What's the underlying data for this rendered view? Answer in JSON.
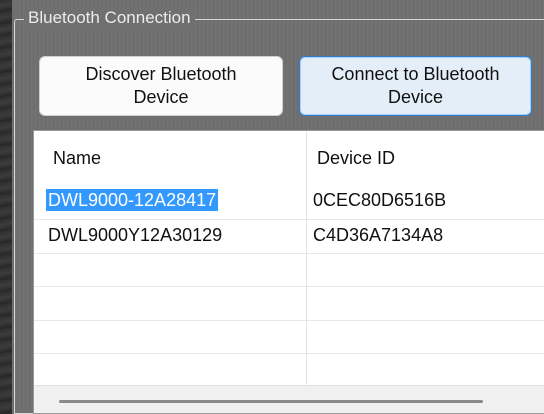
{
  "group": {
    "title": "Bluetooth Connection"
  },
  "buttons": {
    "discover_label": "Discover Bluetooth\nDevice",
    "connect_label": "Connect to Bluetooth\nDevice"
  },
  "device_list": {
    "columns": [
      "Name",
      "Device ID"
    ],
    "rows": [
      {
        "name": "DWL9000-12A28417",
        "device_id": "0CEC80D6516B",
        "selected": true
      },
      {
        "name": "DWL9000Y12A30129",
        "device_id": "C4D36A7134A8",
        "selected": false
      }
    ]
  },
  "colors": {
    "selection": "#3399ff",
    "focus_border": "#2f7fd1",
    "focus_fill": "#e4eef9"
  }
}
